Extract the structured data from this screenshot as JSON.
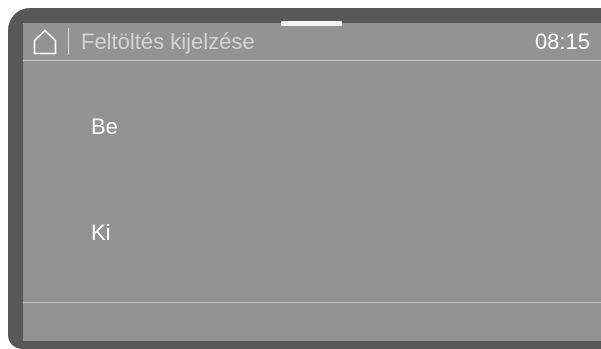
{
  "header": {
    "title": "Feltöltés kijelzése",
    "time": "08:15"
  },
  "options": [
    {
      "label": "Be"
    },
    {
      "label": "Ki"
    }
  ],
  "icons": {
    "home": "home-icon"
  }
}
